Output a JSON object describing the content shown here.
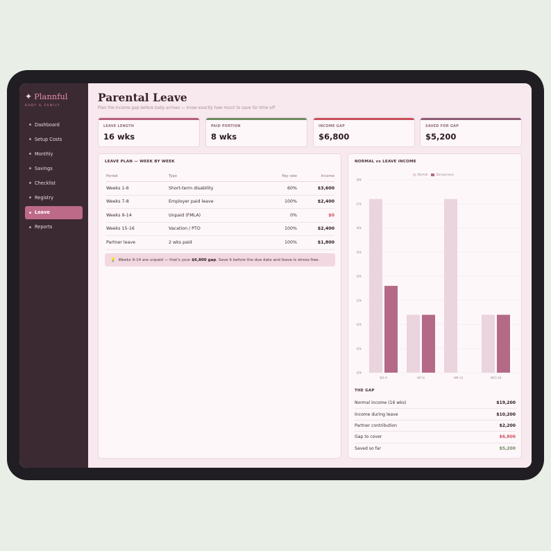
{
  "app": {
    "brand": "Plannful",
    "brand_subtitle": "BABY & FAMILY",
    "brand_icon": "sparkle-icon"
  },
  "sidebar": {
    "items": [
      {
        "label": "Dashboard",
        "active": false
      },
      {
        "label": "Setup Costs",
        "active": false
      },
      {
        "label": "Monthly",
        "active": false
      },
      {
        "label": "Savings",
        "active": false
      },
      {
        "label": "Checklist",
        "active": false
      },
      {
        "label": "Registry",
        "active": false
      },
      {
        "label": "Leave",
        "active": true
      },
      {
        "label": "Reports",
        "active": false
      }
    ]
  },
  "page": {
    "title": "Parental Leave",
    "subtitle": "Plan the income gap before baby arrives — know exactly how much to save for time off"
  },
  "kpis": [
    {
      "label": "LEAVE LENGTH",
      "value": "16 wks",
      "accent": "#b85f7c"
    },
    {
      "label": "PAID PORTION",
      "value": "8 wks",
      "accent": "#6f8a5e"
    },
    {
      "label": "INCOME GAP",
      "value": "$6,800",
      "accent": "#c94e5a"
    },
    {
      "label": "SAVED FOR GAP",
      "value": "$5,200",
      "accent": "#8d5b73"
    }
  ],
  "leave_plan": {
    "title": "LEAVE PLAN — WEEK BY WEEK",
    "columns": {
      "period": "Period",
      "type": "Type",
      "pay": "Pay rate",
      "income": "Income"
    },
    "rows": [
      {
        "period": "Weeks 1-6",
        "type": "Short-term disability",
        "pay": "60%",
        "income": "$3,600",
        "negative": false
      },
      {
        "period": "Weeks 7-8",
        "type": "Employer paid leave",
        "pay": "100%",
        "income": "$2,400",
        "negative": false
      },
      {
        "period": "Weeks 9-14",
        "type": "Unpaid (FMLA)",
        "pay": "0%",
        "income": "$0",
        "negative": true
      },
      {
        "period": "Weeks 15-16",
        "type": "Vacation / PTO",
        "pay": "100%",
        "income": "$2,400",
        "negative": false
      },
      {
        "period": "Partner leave",
        "type": "2 wks paid",
        "pay": "100%",
        "income": "$1,800",
        "negative": false
      }
    ],
    "note": {
      "icon": "lightbulb-icon",
      "text_before": "Weeks 9-14 are unpaid — that's your ",
      "text_bold": "$6,800 gap",
      "text_after": ". Save it before the due date and leave is stress-free."
    }
  },
  "comparison": {
    "title": "NORMAL vs LEAVE INCOME",
    "legend": [
      "Normal",
      "During leave"
    ],
    "colors": {
      "normal": "#ead4dd",
      "leave": "#b46a86",
      "grid": "#f1e4e9",
      "axis": "#a1848f"
    }
  },
  "chart_data": {
    "type": "bar",
    "categories": [
      "W1-6",
      "W7-8",
      "W9-14",
      "W15-16"
    ],
    "series": [
      {
        "name": "Normal",
        "values": [
          7200,
          2400,
          7200,
          2400
        ]
      },
      {
        "name": "During leave",
        "values": [
          3600,
          2400,
          0,
          2400
        ]
      }
    ],
    "yticks": [
      "$0k",
      "$1k",
      "$2k",
      "$3k",
      "$4k",
      "$5k",
      "$6k",
      "$7k",
      "$8k"
    ],
    "ylim": [
      0,
      8000
    ],
    "legend_position": "top-center",
    "grid": true
  },
  "gap": {
    "title": "THE GAP",
    "rows": [
      {
        "label": "Normal income (16 wks)",
        "value": "$19,200",
        "color": "#2b1a21"
      },
      {
        "label": "Income during leave",
        "value": "$10,200",
        "color": "#2b1a21"
      },
      {
        "label": "Partner contribution",
        "value": "$2,200",
        "color": "#2b1a21"
      },
      {
        "label": "Gap to cover",
        "value": "$6,800",
        "color": "#cf4c5d"
      },
      {
        "label": "Saved so far",
        "value": "$5,200",
        "color": "#6f8a5e"
      }
    ]
  }
}
